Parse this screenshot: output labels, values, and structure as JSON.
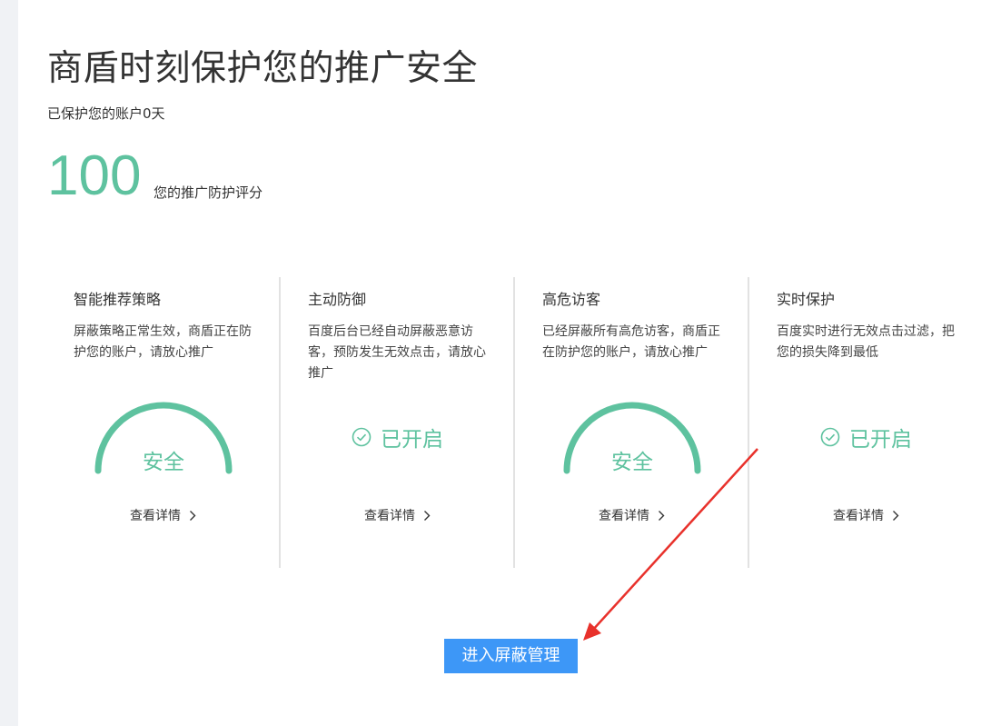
{
  "header": {
    "title": "商盾时刻保护您的推广安全",
    "protected_days": "已保护您的账户0天"
  },
  "score": {
    "value": "100",
    "label": "您的推广防护评分"
  },
  "cards": [
    {
      "title": "智能推荐策略",
      "description": "屏蔽策略正常生效，商盾正在防护您的账户，请放心推广",
      "status": "安全",
      "detail": "查看详情"
    },
    {
      "title": "主动防御",
      "description": "百度后台已经自动屏蔽恶意访客，预防发生无效点击，请放心推广",
      "status": "已开启",
      "detail": "查看详情"
    },
    {
      "title": "高危访客",
      "description": "已经屏蔽所有高危访客，商盾正在防护您的账户，请放心推广",
      "status": "安全",
      "detail": "查看详情"
    },
    {
      "title": "实时保护",
      "description": "百度实时进行无效点击过滤，把您的损失降到最低",
      "status": "已开启",
      "detail": "查看详情"
    }
  ],
  "actions": {
    "enter_button": "进入屏蔽管理"
  },
  "colors": {
    "accent_green": "#5ec29f",
    "button_blue": "#3d97f7",
    "annotation_red": "#e8312b"
  }
}
